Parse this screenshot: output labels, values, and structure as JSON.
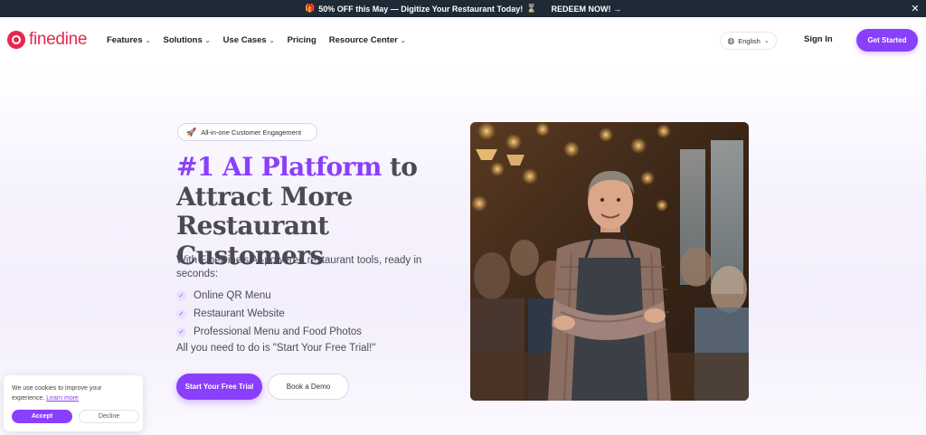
{
  "promo": {
    "gift_icon": "gift-icon",
    "text": "50% OFF this May — Digitize Your Restaurant Today!",
    "hourglass_icon": "hourglass-icon",
    "cta": "REDEEM NOW! →",
    "close": "✕"
  },
  "nav": {
    "logo_text": "finedine",
    "items": [
      {
        "label": "Features",
        "has_dropdown": true
      },
      {
        "label": "Solutions",
        "has_dropdown": true
      },
      {
        "label": "Use Cases",
        "has_dropdown": true
      },
      {
        "label": "Pricing",
        "has_dropdown": false
      },
      {
        "label": "Resource Center",
        "has_dropdown": true
      }
    ],
    "language": "English",
    "signin": "Sign In",
    "get_started": "Get Started"
  },
  "hero": {
    "badge": "All-in-one Customer Engagement",
    "headline_accent": "#1 AI Platform",
    "headline_rest_1": " to",
    "headline_rest_2": "Attract More",
    "headline_rest_3": "Restaurant Customers",
    "subtext": "With FineDine's AI-powered restaurant tools, ready in seconds:",
    "checklist": [
      "Online QR Menu",
      "Restaurant Website",
      "Professional Menu and Food Photos"
    ],
    "tagline": "All you need to do is \"Start Your Free Trial!\"",
    "primary_cta": "Start Your Free Trial",
    "secondary_cta": "Book a Demo",
    "image_subject": "restaurant owner in apron with crossed arms in busy dining room"
  },
  "cookie": {
    "text": "We use cookies to improve your experience.",
    "link": "Learn more",
    "accept": "Accept",
    "decline": "Decline"
  },
  "colors": {
    "brand_red": "#e5284f",
    "accent_purple": "#8a3ffc",
    "promo_bg": "#1f2a37"
  }
}
